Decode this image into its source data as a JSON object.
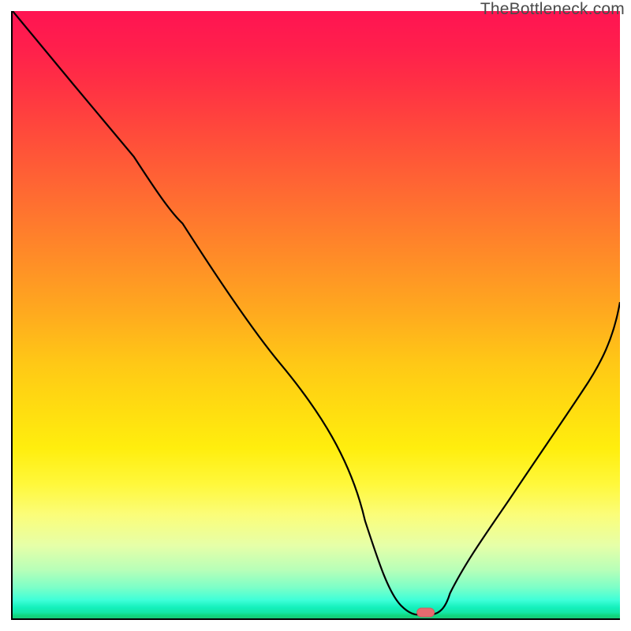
{
  "watermark": "TheBottleneck.com",
  "colors": {
    "gradient_top": "#ff1452",
    "gradient_mid": "#ffde10",
    "gradient_bottom": "#18c878",
    "axis": "#000000",
    "line": "#000000",
    "marker_fill": "#e86a6f",
    "marker_stroke": "#d35a60"
  },
  "chart_data": {
    "type": "line",
    "title": "",
    "xlabel": "",
    "ylabel": "",
    "xlim": [
      0,
      100
    ],
    "ylim": [
      0,
      100
    ],
    "grid": false,
    "series": [
      {
        "name": "bottleneck-curve",
        "x": [
          0,
          10,
          20,
          28,
          36,
          44,
          52,
          58,
          62,
          64,
          67,
          69,
          72,
          78,
          86,
          94,
          100
        ],
        "values": [
          100,
          88,
          76,
          65,
          54,
          42,
          28,
          16,
          7,
          2,
          0.6,
          0.6,
          4,
          14,
          28,
          42,
          52
        ]
      }
    ],
    "marker": {
      "name": "optimal-point",
      "x": 68,
      "y": 0.8,
      "shape": "rounded-rect"
    },
    "legend": false
  }
}
